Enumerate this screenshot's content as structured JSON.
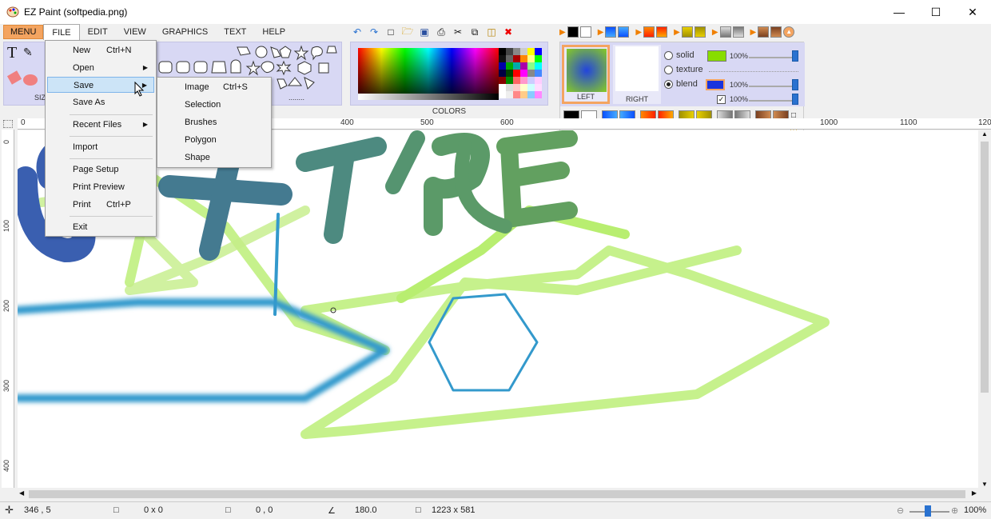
{
  "window": {
    "title": "EZ Paint (softpedia.png)"
  },
  "menubar": {
    "menu": "MENU",
    "items": [
      "FILE",
      "EDIT",
      "VIEW",
      "GRAPHICS",
      "TEXT",
      "HELP"
    ]
  },
  "file_menu": {
    "new": "New",
    "new_shortcut": "Ctrl+N",
    "open": "Open",
    "save": "Save",
    "save_as": "Save As",
    "recent": "Recent Files",
    "import": "Import",
    "page_setup": "Page Setup",
    "print_preview": "Print Preview",
    "print": "Print",
    "print_shortcut": "Ctrl+P",
    "exit": "Exit"
  },
  "save_submenu": {
    "image": "Image",
    "image_shortcut": "Ctrl+S",
    "selection": "Selection",
    "brushes": "Brushes",
    "polygon": "Polygon",
    "shape": "Shape"
  },
  "ribbon": {
    "size_label": "SIZ",
    "colors_label": "COLORS",
    "shapes_dots": "........"
  },
  "color_panel": {
    "left_label": "LEFT",
    "right_label": "RIGHT",
    "solid": "solid",
    "texture": "texture",
    "blend": "blend",
    "solid_pct": "100%",
    "blend_pct": "100%",
    "check_pct": "100%",
    "solid_color": "#88dd00",
    "blend_color": "#1a33dd"
  },
  "ruler": {
    "h": [
      "0",
      "400",
      "500",
      "600",
      "1000",
      "1100",
      "120"
    ],
    "v": [
      "0",
      "100",
      "200",
      "300",
      "400"
    ]
  },
  "status": {
    "cursor": "346 , 5",
    "selection_size": "0 x 0",
    "offset": "0 , 0",
    "angle": "180.0",
    "image_size": "1223 x 581",
    "zoom": "100%"
  }
}
